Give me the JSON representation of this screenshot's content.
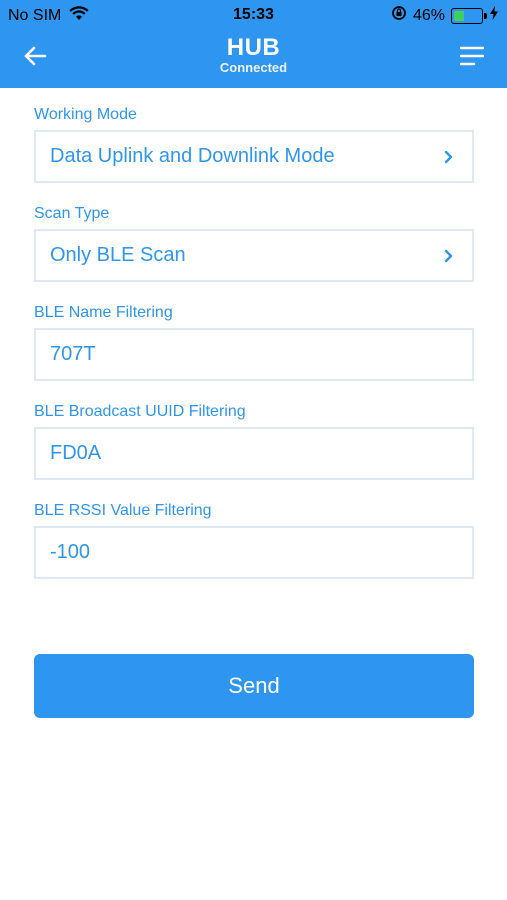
{
  "status_bar": {
    "carrier": "No SIM",
    "time": "15:33",
    "battery_percent": "46%",
    "battery_level": 0.46,
    "icons": [
      "wifi-icon",
      "orientation-lock-icon",
      "battery-icon",
      "charging-icon"
    ]
  },
  "header": {
    "title": "HUB",
    "subtitle": "Connected",
    "back_icon": "arrow-left-icon",
    "menu_icon": "menu-icon",
    "background": "#2e96f0"
  },
  "form": {
    "working_mode": {
      "label": "Working Mode",
      "value": "Data Uplink and Downlink Mode"
    },
    "scan_type": {
      "label": "Scan Type",
      "value": "Only BLE Scan"
    },
    "ble_name_filter": {
      "label": "BLE Name Filtering",
      "value": "707T"
    },
    "ble_uuid_filter": {
      "label": "BLE Broadcast UUID Filtering",
      "value": "FD0A"
    },
    "ble_rssi_filter": {
      "label": "BLE RSSI Value Filtering",
      "value": "-100"
    }
  },
  "actions": {
    "send_label": "Send"
  },
  "colors": {
    "accent": "#2e96f0",
    "field_border": "#dfe9f3"
  }
}
